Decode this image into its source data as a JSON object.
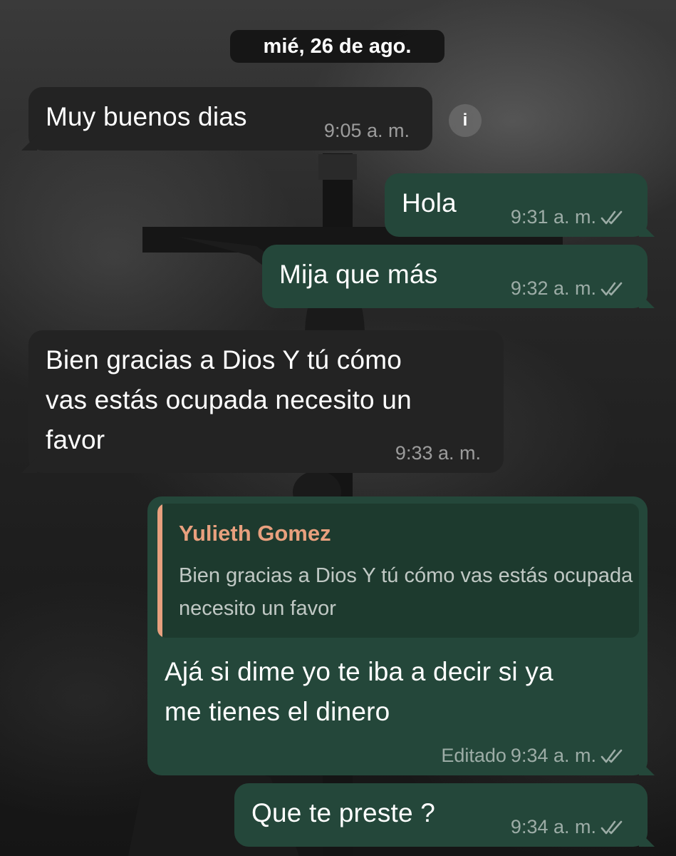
{
  "date_separator": "mié, 26 de ago.",
  "messages": [
    {
      "direction": "in",
      "text": "Muy buenos dias",
      "time": "9:05 a. m."
    },
    {
      "direction": "out",
      "text": "Hola",
      "time": "9:31 a. m.",
      "status": "read"
    },
    {
      "direction": "out",
      "text": "Mija que más",
      "time": "9:32 a. m.",
      "status": "read"
    },
    {
      "direction": "in",
      "lines": [
        "Bien gracias a Dios Y tú cómo",
        "vas estás ocupada necesito un",
        "favor"
      ],
      "time": "9:33 a. m."
    },
    {
      "direction": "out",
      "reply": {
        "author": "Yulieth Gomez",
        "text": "Bien gracias a Dios Y tú cómo vas estás ocupada necesito un favor"
      },
      "lines": [
        "Ajá si dime yo te  iba a decir si ya",
        "me tienes el dinero"
      ],
      "edited_label": "Editado",
      "time": "9:34 a. m.",
      "status": "read"
    },
    {
      "direction": "out",
      "text": "Que te preste ?",
      "time": "9:34 a. m.",
      "status": "read"
    }
  ],
  "icons": {
    "info": "info-icon",
    "read_receipt": "double-check-icon"
  },
  "colors": {
    "outgoing_bubble": "#24473a",
    "incoming_bubble": "#232323",
    "reply_author": "#e8a07e"
  }
}
